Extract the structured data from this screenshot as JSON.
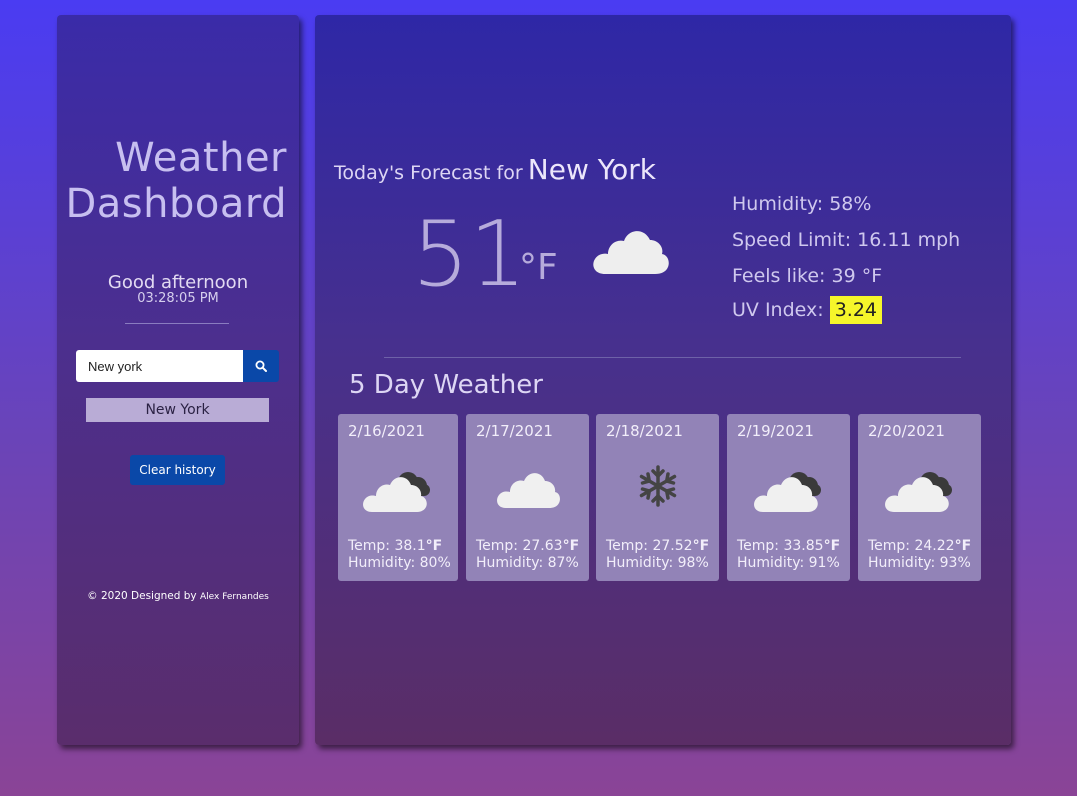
{
  "sidebar": {
    "title_line1": "Weather",
    "title_line2": "Dashboard",
    "greeting": "Good afternoon",
    "time": "03:28:05 PM",
    "search": {
      "value": "New york",
      "button_icon": "search-icon"
    },
    "history": [
      "New York"
    ],
    "clear_label": "Clear history",
    "footer": {
      "prefix": "© 2020 Designed by",
      "author": "Alex Fernandes"
    }
  },
  "today": {
    "label": "Today's Forecast for",
    "city": "New York",
    "temp": "51",
    "unit": "°F",
    "icon": "cloud-icon",
    "humidity": "Humidity: 58%",
    "speed": "Speed Limit: 16.11 mph",
    "feels": "Feels like: 39 °F",
    "uv_label": "UV Index:",
    "uv_value": "3.24",
    "uv_color": "#f6f62a"
  },
  "forecast": {
    "title": "5 Day Weather",
    "temp_label": "Temp:",
    "unit": "°F",
    "days": [
      {
        "date": "2/16/2021",
        "temp": "38.1",
        "humidity": "Humidity: 80%",
        "icon": "cloud-dark-icon"
      },
      {
        "date": "2/17/2021",
        "temp": "27.63",
        "humidity": "Humidity: 87%",
        "icon": "cloud-icon"
      },
      {
        "date": "2/18/2021",
        "temp": "27.52",
        "humidity": "Humidity: 98%",
        "icon": "snowflake-icon"
      },
      {
        "date": "2/19/2021",
        "temp": "33.85",
        "humidity": "Humidity: 91%",
        "icon": "cloud-dark-icon"
      },
      {
        "date": "2/20/2021",
        "temp": "24.22",
        "humidity": "Humidity: 93%",
        "icon": "cloud-dark-icon"
      }
    ]
  }
}
